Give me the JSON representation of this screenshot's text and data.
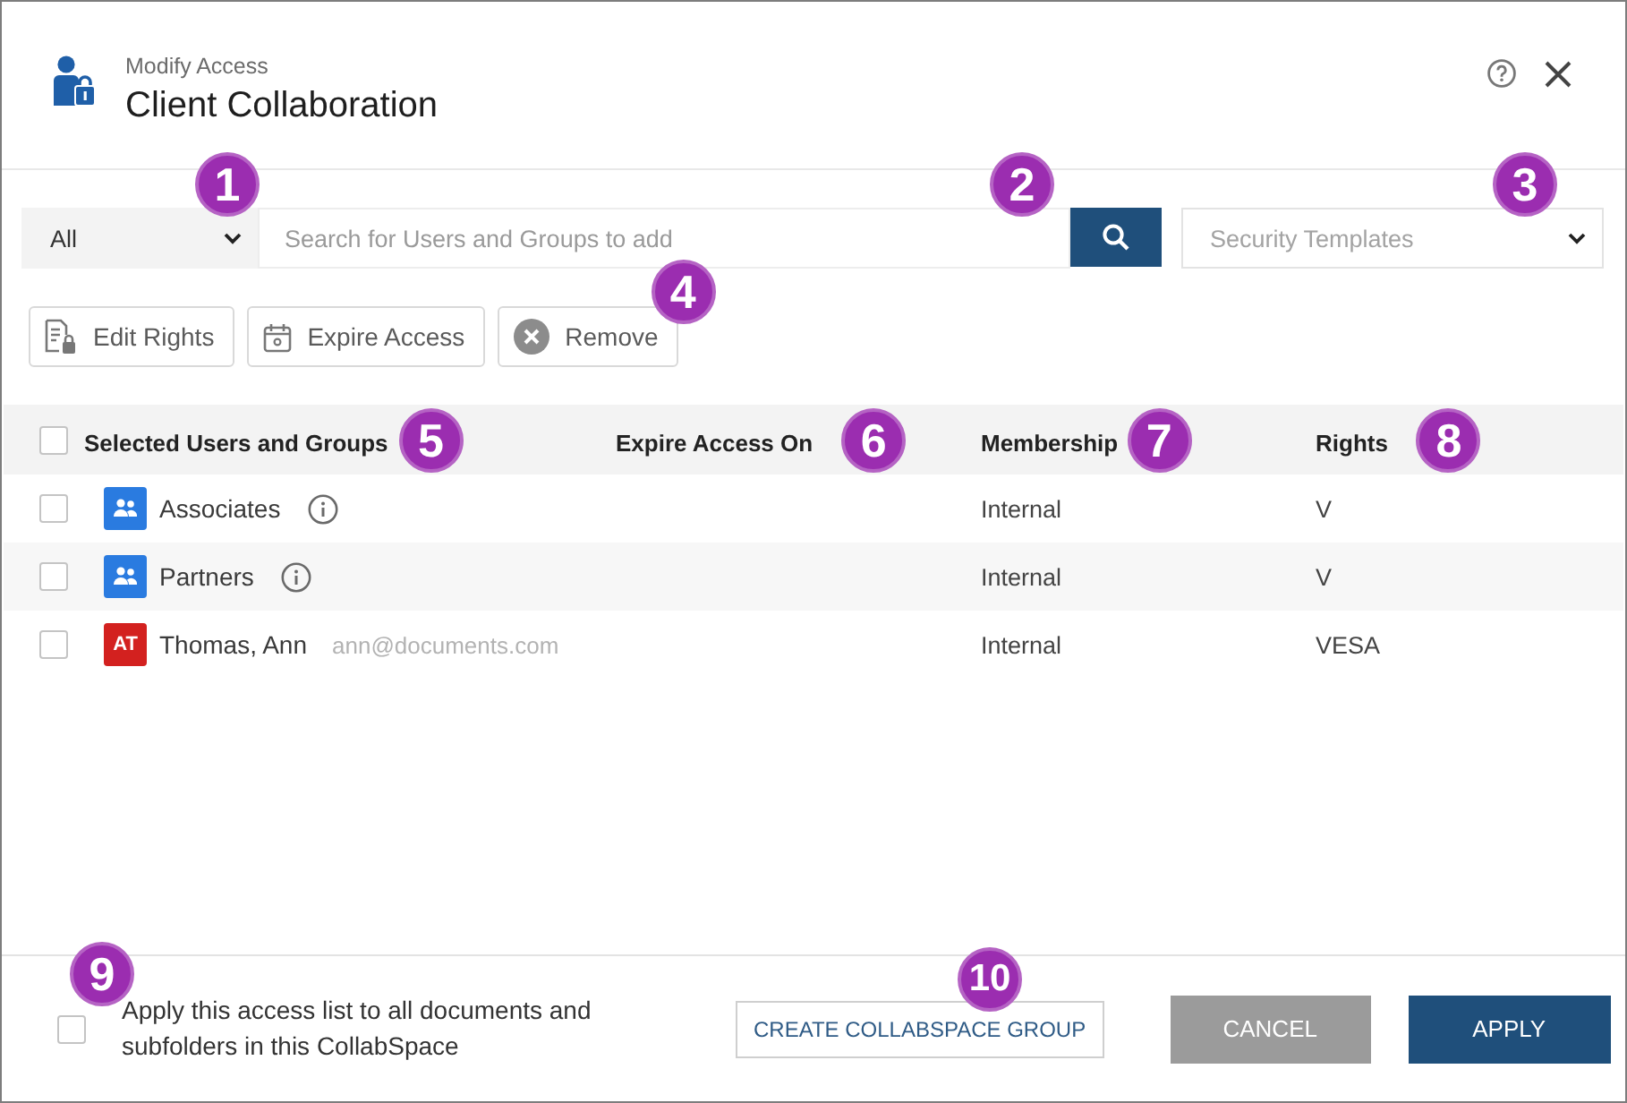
{
  "header": {
    "subtitle": "Modify Access",
    "title": "Client Collaboration"
  },
  "search_bar": {
    "scope": {
      "value": "All",
      "callout": "1"
    },
    "search": {
      "placeholder": "Search for Users and Groups to add"
    },
    "search_button": {
      "callout": "2"
    },
    "templates": {
      "placeholder": "Security Templates",
      "callout": "3"
    }
  },
  "toolbar": [
    {
      "kind": "edit_rights",
      "label": "Edit Rights"
    },
    {
      "kind": "expire",
      "label": "Expire Access"
    },
    {
      "kind": "remove",
      "label": "Remove",
      "callout": "4"
    }
  ],
  "table": {
    "select_all": {
      "checked": false
    },
    "columns": [
      {
        "label": "Selected Users and Groups",
        "callout": "5"
      },
      {
        "label": "Expire Access On",
        "callout": "6"
      },
      {
        "label": "Membership",
        "callout": "7"
      },
      {
        "label": "Rights",
        "callout": "8"
      }
    ],
    "rows": [
      {
        "kind": "group",
        "checked": false,
        "name": "Associates",
        "membership": "Internal",
        "rights": "V"
      },
      {
        "kind": "group",
        "checked": false,
        "name": "Partners",
        "membership": "Internal",
        "rights": "V"
      },
      {
        "kind": "user",
        "checked": false,
        "initials": "AT",
        "name": "Thomas, Ann",
        "email": "ann@documents.com",
        "membership": "Internal",
        "rights": "VESA"
      }
    ]
  },
  "footer": {
    "apply_all": {
      "checked": false,
      "label": "Apply this access list to all documents and subfolders in this CollabSpace",
      "callout": "9"
    },
    "buttons": [
      {
        "kind": "outline",
        "label": "CREATE COLLABSPACE GROUP",
        "callout": "10"
      },
      {
        "kind": "secondary",
        "label": "CANCEL"
      },
      {
        "kind": "primary",
        "label": "APPLY"
      }
    ]
  }
}
